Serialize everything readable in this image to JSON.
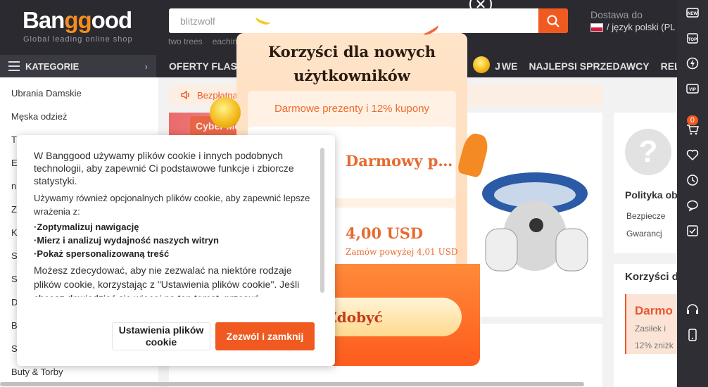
{
  "header": {
    "logo_text_1": "Ban",
    "logo_text_2": "gg",
    "logo_text_3": "ood",
    "tagline": "Global leading online shop",
    "search_value": "blitzwolf",
    "hot_searches": [
      "two trees",
      "eachin"
    ],
    "ship_to_label": "Dostawa do",
    "language_label": "/ język polski (PL"
  },
  "category_button": {
    "label": "KATEGORIE"
  },
  "top_nav": [
    "OFERTY FLASH",
    "J",
    "WE",
    "NAJLEPSI SPRZEDAWCY",
    "RELACJA"
  ],
  "sidebar": {
    "items": [
      "Ubrania Damskie",
      "Męska odzież",
      "T",
      "E",
      "n",
      "Z",
      "K",
      "S",
      "S",
      "D",
      "B",
      "S",
      "Buty & Torby"
    ]
  },
  "notice": {
    "text": "Bezpłatna"
  },
  "banner": {
    "promo_tag": "Cyber Monday"
  },
  "right_panel": {
    "policy_title": "Polityka ob",
    "item1": "Bezpiecze",
    "item2": "Gwarancj",
    "benefits_title": "Korzyści d",
    "card_title": "Darmo",
    "card_line1": "Zasiłek i",
    "card_line2": "12% zniżk"
  },
  "right_bar": {
    "cart_count": "0",
    "icons": [
      "new-icon",
      "top-icon",
      "flash-icon",
      "vip-icon",
      "cart-icon",
      "heart-icon",
      "clock-icon",
      "message-icon",
      "check-icon",
      "headset-icon",
      "phone-icon"
    ]
  },
  "popup": {
    "title": "Korzyści dla nowych użytkowników",
    "subtitle": "Darmowe prezenty i 12% kupony",
    "coupon1_text": "Darmowy p…",
    "coupon2_value": "4,00 USD",
    "coupon2_condition": "Zamów powyżej 4,01 USD",
    "claim_button": "Zdobyć"
  },
  "cookie": {
    "para1": "W Banggood używamy plików cookie i innych podobnych technologii, aby zapewnić Ci podstawowe funkcje i zbiorcze statystyki.",
    "para2": "Używamy również opcjonalnych plików cookie, aby zapewnić lepsze wrażenia z:",
    "bullet1": "·Zoptymalizuj nawigację",
    "bullet2": "·Mierz i analizuj wydajność naszych witryn",
    "bullet3": "·Pokaż spersonalizowaną treść",
    "para3": "Możesz zdecydować, aby nie zezwalać na niektóre rodzaje plików cookie, korzystając z \"Ustawienia plików cookie\". Jeśli chcesz dowiedzieć się więcej na ten temat, przesuń",
    "settings_button": "Ustawienia plików cookie",
    "accept_button": "Zezwól i zamknij"
  },
  "colors": {
    "accent": "#f05a20",
    "header_bg": "#2a2a30",
    "popup_orange": "#fd5c1d"
  }
}
